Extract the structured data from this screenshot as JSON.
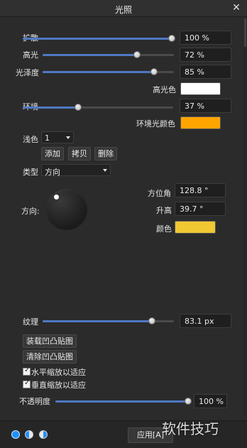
{
  "window": {
    "title": "光照"
  },
  "bump": {
    "label": "扩散",
    "value": "100 %",
    "level": 1.0
  },
  "highlight": {
    "label": "高光",
    "value": "72 %",
    "level": 0.72
  },
  "gloss": {
    "label": "光泽度",
    "value": "85 %",
    "level": 0.85
  },
  "highlight_color": {
    "label": "高光色",
    "color": "#ffffff"
  },
  "ambient": {
    "label": "环境",
    "value": "37 %",
    "level": 0.37
  },
  "ambient_color": {
    "label": "环境光颜色",
    "color": "#ffa500"
  },
  "light": {
    "label": "浅色",
    "selected": "1"
  },
  "buttons": {
    "add": "添加",
    "copy": "拷贝",
    "delete": "删除"
  },
  "type": {
    "label": "类型",
    "selected": "方向"
  },
  "direction": {
    "label": "方向:",
    "azimuth_label": "方位角",
    "azimuth_value": "128.8 °",
    "elevation_label": "升高",
    "elevation_value": "39.7 °",
    "color_label": "颜色",
    "color": "#f0c832"
  },
  "texture": {
    "label": "纹理",
    "value": "83.1 px",
    "level": 0.83
  },
  "bump_map": {
    "load": "装载凹凸贴图",
    "clear": "清除凹凸贴图"
  },
  "scale": {
    "horizontal": "水平缩放以适应",
    "horizontal_checked": true,
    "vertical": "垂直缩放以适应",
    "vertical_checked": true
  },
  "opacity": {
    "label": "不透明度",
    "value": "100 %",
    "level": 1.0
  },
  "footer": {
    "apply_label": "应用[A]",
    "icons": [
      "blend-mode-normal-icon",
      "blend-mode-split-icon",
      "blend-mode-invert-icon"
    ],
    "watermark": "软件技巧"
  }
}
